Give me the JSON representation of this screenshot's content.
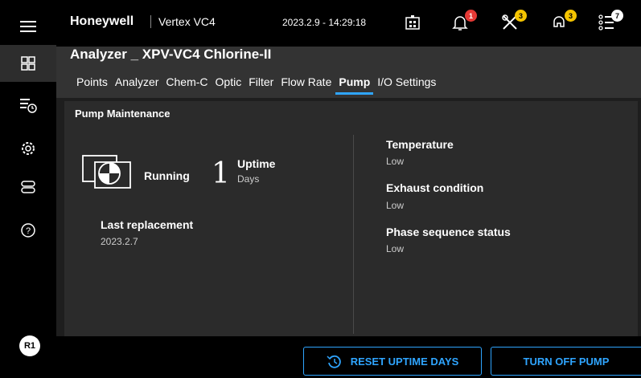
{
  "topbar": {
    "brand": "Honeywell",
    "product": "Vertex VC4",
    "datetime": "2023.2.9 - 14:29:18",
    "icons": [
      {
        "name": "network-icon",
        "badge": null
      },
      {
        "name": "alarm-bell-icon",
        "badge": "1",
        "badge_color": "#e53935"
      },
      {
        "name": "tools-icon",
        "badge": "3",
        "badge_color": "#f5c400"
      },
      {
        "name": "maintenance-icon",
        "badge": "3",
        "badge_color": "#f5c400"
      },
      {
        "name": "event-list-icon",
        "badge": "7",
        "badge_color": "#ffffff"
      }
    ]
  },
  "sidebar": {
    "items": [
      {
        "name": "menu-icon"
      },
      {
        "name": "dashboard-icon",
        "active": true
      },
      {
        "name": "history-list-icon"
      },
      {
        "name": "settings-gear-icon"
      },
      {
        "name": "device-icon"
      },
      {
        "name": "help-icon"
      }
    ],
    "user": "R1"
  },
  "header": {
    "title": "Analyzer _ XPV-VC4 Chlorine-II",
    "tabs": [
      "Points",
      "Analyzer",
      "Chem-C",
      "Optic",
      "Filter",
      "Flow Rate",
      "Pump",
      "I/O Settings"
    ],
    "active_tab": "Pump"
  },
  "card": {
    "title": "Pump Maintenance",
    "status": "Running",
    "uptime_value": "1",
    "uptime_label": "Uptime",
    "uptime_unit": "Days",
    "last_replacement_label": "Last replacement",
    "last_replacement_value": "2023.2.7",
    "stats": [
      {
        "label": "Temperature",
        "value": "Low"
      },
      {
        "label": "Exhaust condition",
        "value": "Low"
      },
      {
        "label": "Phase sequence status",
        "value": "Low"
      }
    ]
  },
  "footer": {
    "reset_label": "RESET UPTIME DAYS",
    "turn_off_label": "TURN OFF PUMP"
  },
  "colors": {
    "accent": "#2fa5ff",
    "background": "#1e1e1e",
    "card": "#2b2b2b"
  }
}
